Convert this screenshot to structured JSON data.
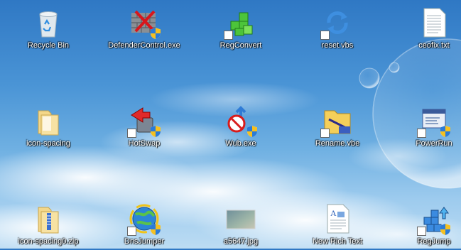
{
  "desktop": {
    "icons": [
      {
        "label": "Recycle Bin"
      },
      {
        "label": "DefenderControl.exe"
      },
      {
        "label": "RegConvert"
      },
      {
        "label": "reset.vbs"
      },
      {
        "label": "ceofix.txt"
      },
      {
        "label": "icon-spacing"
      },
      {
        "label": "HotSwap"
      },
      {
        "label": "Wub.exe"
      },
      {
        "label": "Rename.vbe"
      },
      {
        "label": "PowerRun"
      },
      {
        "label": "icon-spacing0.zip"
      },
      {
        "label": "DnsJumper"
      },
      {
        "label": "a5647.jpg"
      },
      {
        "label": "New Rich Text"
      },
      {
        "label": "RegJump"
      }
    ]
  },
  "colors": {
    "sky_top": "#2f78c4",
    "sky_bottom": "#bcdcf3",
    "label_text": "#ffffff"
  }
}
